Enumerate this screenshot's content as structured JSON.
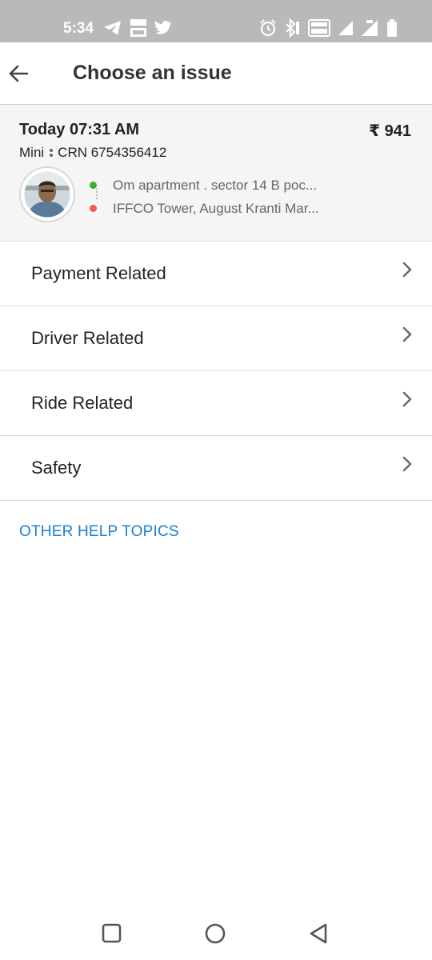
{
  "status_bar": {
    "time": "5:34",
    "left_icons": [
      "telegram-icon",
      "tata-1mg-icon",
      "twitter-icon"
    ],
    "right_icons": [
      "alarm-icon",
      "bluetooth-icon",
      "volte-icon",
      "signal-icon",
      "signal-4g-icon",
      "battery-icon"
    ]
  },
  "app_bar": {
    "title": "Choose an issue"
  },
  "ride": {
    "date": "Today 07:31 AM",
    "fare": "₹ 941",
    "category": "Mini",
    "crn": "CRN 6754356412",
    "pickup": "Om apartment . sector 14 B poc...",
    "drop": "IFFCO Tower, August Kranti Mar..."
  },
  "issues": [
    {
      "label": "Payment Related"
    },
    {
      "label": "Driver Related"
    },
    {
      "label": "Ride Related"
    },
    {
      "label": "Safety"
    }
  ],
  "other_help": "OTHER HELP TOPICS",
  "colors": {
    "status_bar": "#b9b9b9",
    "link": "#1b7fd4",
    "pickup_dot": "#32b132",
    "drop_dot": "#ef5a4b"
  }
}
